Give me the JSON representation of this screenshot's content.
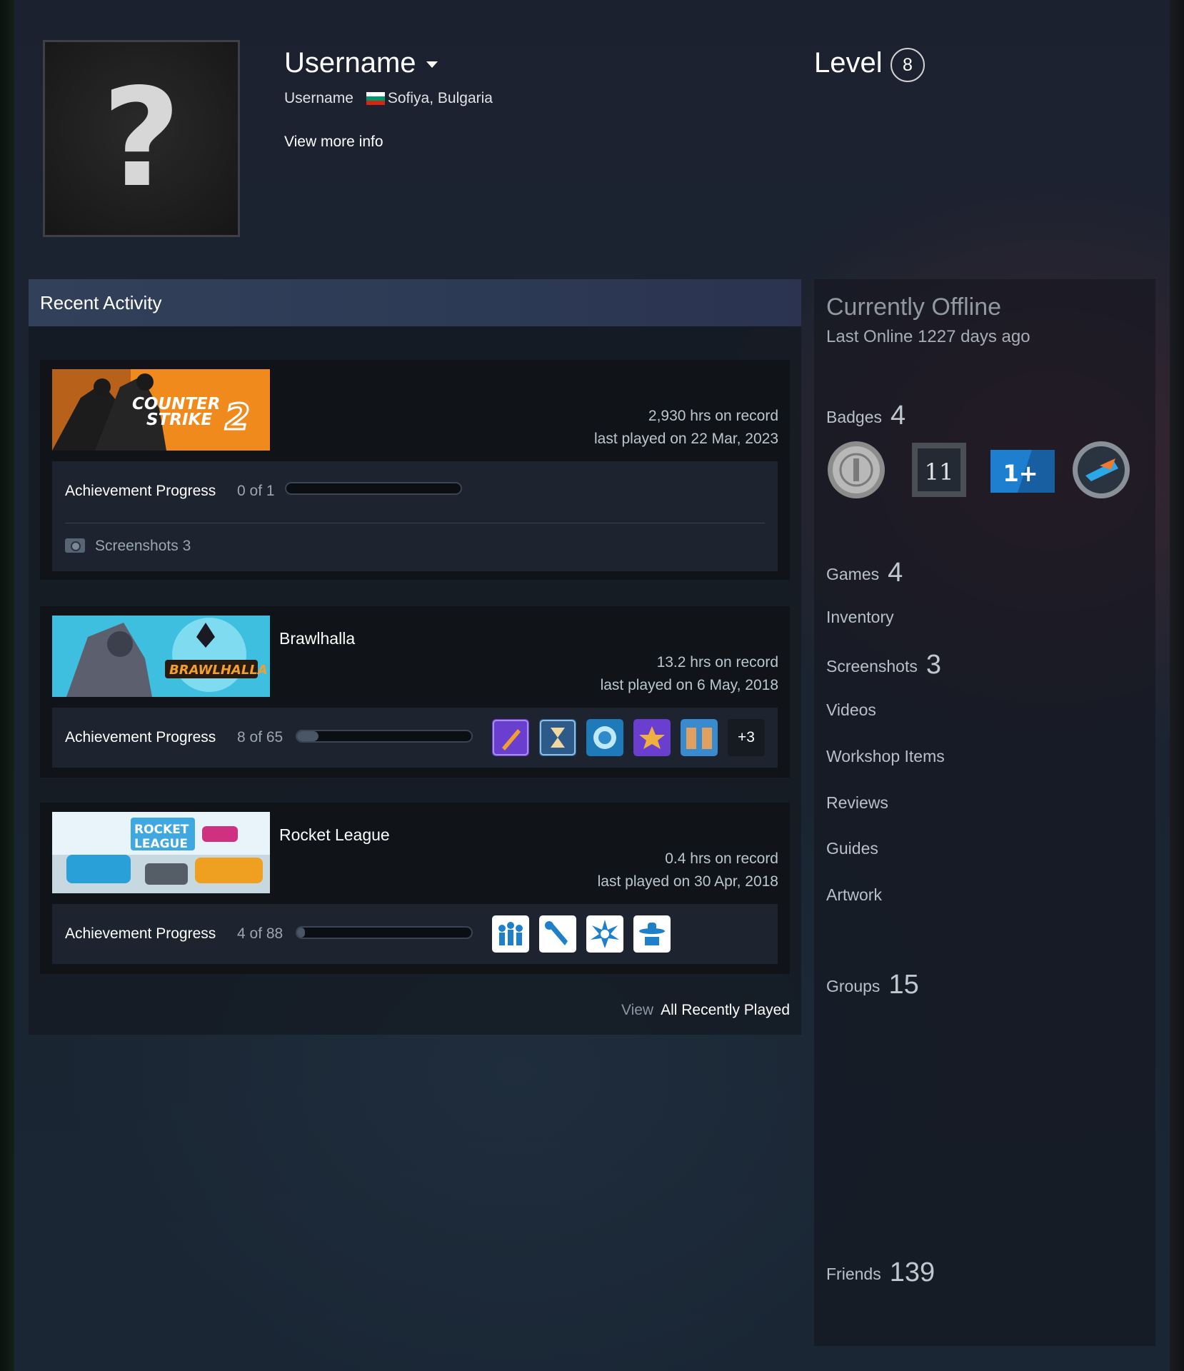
{
  "profile": {
    "username": "Username",
    "real_name": "Username",
    "location": "Sofiya, Bulgaria",
    "view_more": "View more info",
    "level_label": "Level",
    "level": "8"
  },
  "recent_activity": {
    "title": "Recent Activity",
    "games": [
      {
        "name": "",
        "hours": "2,930 hrs on record",
        "last_played": "last played on 22 Mar, 2023",
        "ach_label": "Achievement Progress",
        "ach_count": "0 of 1",
        "ach_fraction": 0.0,
        "screenshots": "Screenshots 3"
      },
      {
        "name": "Brawlhalla",
        "hours": "13.2 hrs on record",
        "last_played": "last played on 6 May, 2018",
        "ach_label": "Achievement Progress",
        "ach_count": "8 of 65",
        "ach_fraction": 0.123,
        "more": "+3"
      },
      {
        "name": "Rocket League",
        "hours": "0.4 hrs on record",
        "last_played": "last played on 30 Apr, 2018",
        "ach_label": "Achievement Progress",
        "ach_count": "4 of 88",
        "ach_fraction": 0.045
      }
    ],
    "view_label": "View",
    "view_all": "All Recently Played"
  },
  "sidebar": {
    "status": "Currently Offline",
    "last_online": "Last Online 1227 days ago",
    "badges_label": "Badges",
    "badges_count": "4",
    "games_label": "Games",
    "games_count": "4",
    "inventory": "Inventory",
    "screenshots_label": "Screenshots",
    "screenshots_count": "3",
    "videos": "Videos",
    "workshop": "Workshop Items",
    "reviews": "Reviews",
    "guides": "Guides",
    "artwork": "Artwork",
    "groups_label": "Groups",
    "groups_count": "15",
    "friends_label": "Friends",
    "friends_count": "139",
    "badge_texts": [
      "11",
      "1+"
    ]
  },
  "banners": {
    "cs_line1": "COUNTER",
    "cs_line2": "STRIKE",
    "cs_num": "2",
    "brawl": "BRAWLHALLA",
    "rl_line1": "ROCKET",
    "rl_line2": "LEAGUE"
  },
  "colors": {
    "accent_blue": "#2d7ac9",
    "cs_orange": "#f08a1c",
    "brawl_cyan": "#3fbfe0"
  }
}
